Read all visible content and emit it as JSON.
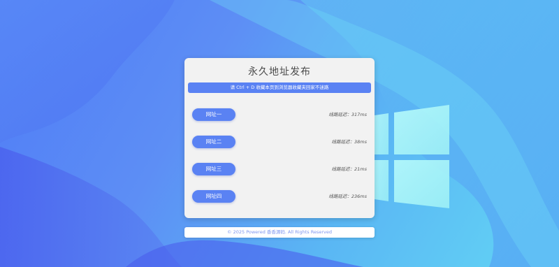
{
  "page": {
    "title": "永久地址发布",
    "notice": "请 Ctrl + D 收藏本页到浏览器收藏夹回家不迷路"
  },
  "links": [
    {
      "label": "网址一",
      "latency": "线路延迟：317ms"
    },
    {
      "label": "网址二",
      "latency": "线路延迟：38ms"
    },
    {
      "label": "网址三",
      "latency": "线路延迟：21ms"
    },
    {
      "label": "网址四",
      "latency": "线路延迟：236ms"
    }
  ],
  "footer": {
    "text": "© 2025 Powered 香香源码. All Rights Reserved"
  },
  "colors": {
    "accent": "#5a82f3",
    "card_bg": "#f2f2f2",
    "bg_blue": "#4f7cf6",
    "bg_cyan": "#63d6f4",
    "footer_text": "#7e95ef"
  },
  "icons": {
    "background_logo": "windows-logo-icon"
  }
}
